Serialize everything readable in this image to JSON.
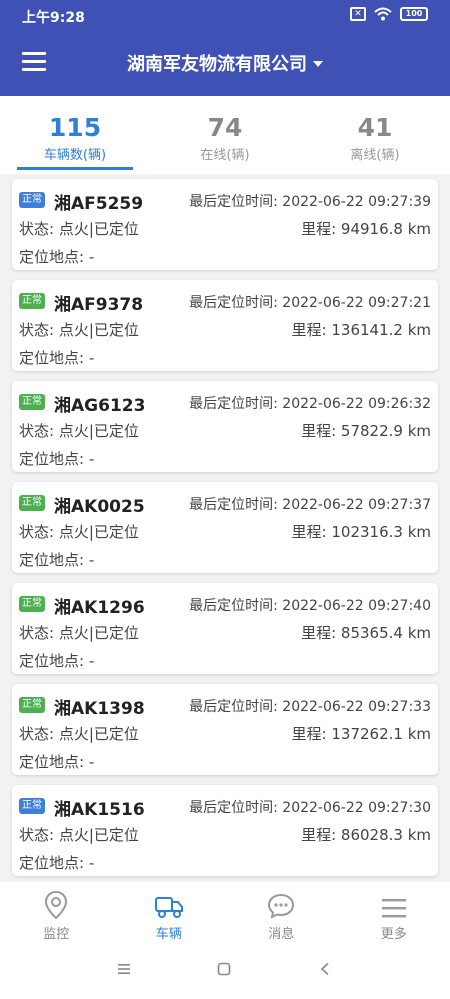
{
  "status_bar": {
    "time": "上午9:28",
    "battery": "100"
  },
  "header": {
    "company": "湖南军友物流有限公司"
  },
  "stats": [
    {
      "value": "115",
      "label": "车辆数(辆)"
    },
    {
      "value": "74",
      "label": "在线(辆)"
    },
    {
      "value": "41",
      "label": "离线(辆)"
    }
  ],
  "vehicles": [
    {
      "badge": "正常",
      "badge_color": "#3f7fd8",
      "plate": "湘AF5259",
      "last_time": "最后定位时间: 2022-06-22 09:27:39",
      "status": "状态: 点火|已定位",
      "mileage": "里程: 94916.8 km",
      "location": "定位地点: -"
    },
    {
      "badge": "正常",
      "badge_color": "#4caf50",
      "plate": "湘AF9378",
      "last_time": "最后定位时间: 2022-06-22 09:27:21",
      "status": "状态: 点火|已定位",
      "mileage": "里程: 136141.2 km",
      "location": "定位地点: -"
    },
    {
      "badge": "正常",
      "badge_color": "#4caf50",
      "plate": "湘AG6123",
      "last_time": "最后定位时间: 2022-06-22 09:26:32",
      "status": "状态: 点火|已定位",
      "mileage": "里程: 57822.9 km",
      "location": "定位地点: -"
    },
    {
      "badge": "正常",
      "badge_color": "#4caf50",
      "plate": "湘AK0025",
      "last_time": "最后定位时间: 2022-06-22 09:27:37",
      "status": "状态: 点火|已定位",
      "mileage": "里程: 102316.3 km",
      "location": "定位地点: -"
    },
    {
      "badge": "正常",
      "badge_color": "#4caf50",
      "plate": "湘AK1296",
      "last_time": "最后定位时间: 2022-06-22 09:27:40",
      "status": "状态: 点火|已定位",
      "mileage": "里程: 85365.4 km",
      "location": "定位地点: -"
    },
    {
      "badge": "正常",
      "badge_color": "#4caf50",
      "plate": "湘AK1398",
      "last_time": "最后定位时间: 2022-06-22 09:27:33",
      "status": "状态: 点火|已定位",
      "mileage": "里程: 137262.1 km",
      "location": "定位地点: -"
    },
    {
      "badge": "正常",
      "badge_color": "#3f7fd8",
      "plate": "湘AK1516",
      "last_time": "最后定位时间: 2022-06-22 09:27:30",
      "status": "状态: 点火|已定位",
      "mileage": "里程: 86028.3 km",
      "location": "定位地点: -"
    }
  ],
  "tabs": [
    {
      "label": "监控",
      "icon": "location-pin-icon"
    },
    {
      "label": "车辆",
      "icon": "truck-icon"
    },
    {
      "label": "消息",
      "icon": "chat-bubble-icon"
    },
    {
      "label": "更多",
      "icon": "menu-lines-icon"
    }
  ],
  "colors": {
    "primary": "#3f51b5",
    "accent": "#2f7ed8",
    "badge_blue": "#3f7fd8",
    "badge_green": "#4caf50"
  }
}
